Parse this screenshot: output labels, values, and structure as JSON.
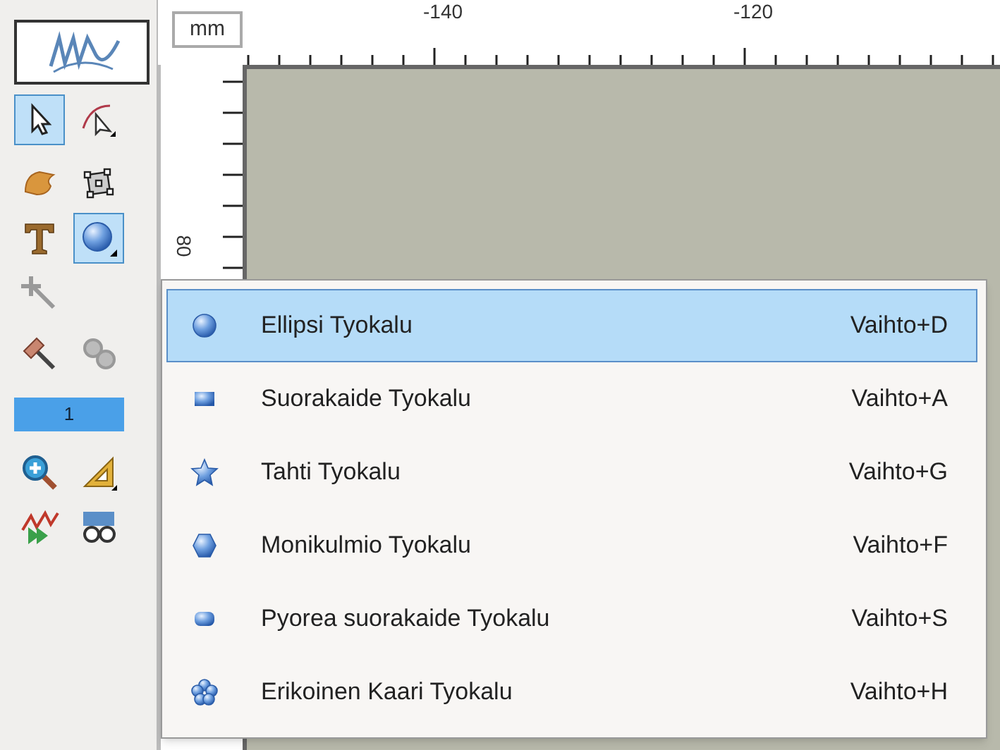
{
  "ruler": {
    "unit": "mm",
    "top_labels": [
      "-140",
      "-120"
    ],
    "left_labels": [
      "80"
    ]
  },
  "toolbar": {
    "tools": [
      {
        "selected": true
      },
      {
        "selected": false
      },
      {
        "selected": false
      },
      {
        "selected": false
      },
      {
        "selected": false
      },
      {
        "selected": true
      },
      {
        "selected": false
      },
      {
        "selected": false
      },
      {
        "selected": false
      }
    ],
    "page_field": "1",
    "tools_after": [
      {
        "selected": false
      },
      {
        "selected": false
      },
      {
        "selected": false
      },
      {
        "selected": false
      }
    ]
  },
  "menu": {
    "items": [
      {
        "label": "Ellipsi Tyokalu",
        "shortcut": "Vaihto+D",
        "selected": true
      },
      {
        "label": "Suorakaide Tyokalu",
        "shortcut": "Vaihto+A",
        "selected": false
      },
      {
        "label": "Tahti Tyokalu",
        "shortcut": "Vaihto+G",
        "selected": false
      },
      {
        "label": "Monikulmio Tyokalu",
        "shortcut": "Vaihto+F",
        "selected": false
      },
      {
        "label": "Pyorea suorakaide Tyokalu",
        "shortcut": "Vaihto+S",
        "selected": false
      },
      {
        "label": "Erikoinen Kaari Tyokalu",
        "shortcut": "Vaihto+H",
        "selected": false
      }
    ]
  }
}
